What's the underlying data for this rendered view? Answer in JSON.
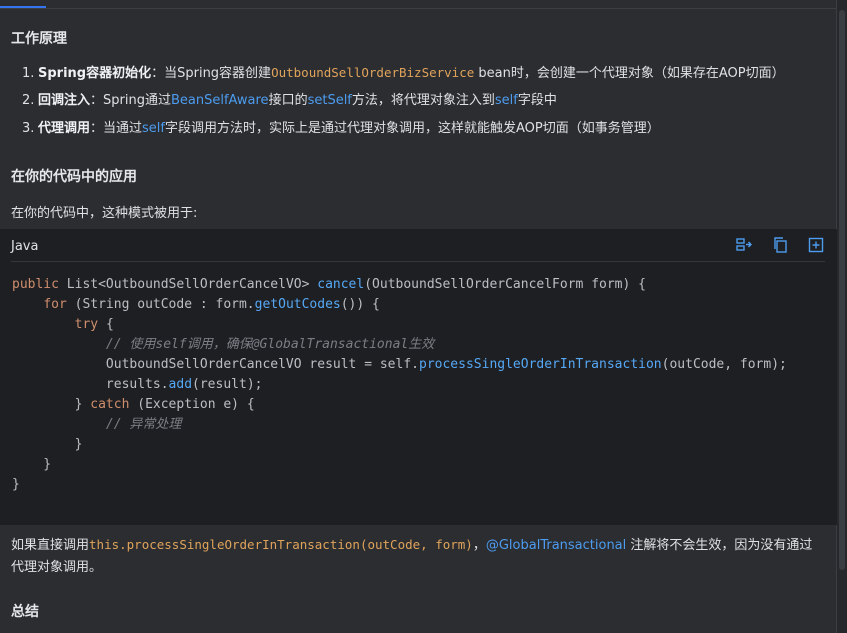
{
  "section_principle": {
    "title": "工作原理",
    "items": [
      {
        "num": "1.",
        "bold": "Spring容器初始化",
        "p1": "：当Spring容器创建",
        "code": "OutboundSellOrderBizService",
        "p2": " bean时，会创建一个代理对象（如果存在AOP切面）"
      },
      {
        "num": "2.",
        "bold": "回调注入",
        "p1": "：Spring通过",
        "link1": "BeanSelfAware",
        "p2": "接口的",
        "link2": "setSelf",
        "p3": "方法，将代理对象注入到",
        "link3": "self",
        "p4": "字段中"
      },
      {
        "num": "3.",
        "bold": "代理调用",
        "p1": "：当通过",
        "link1": "self",
        "p2": "字段调用方法时，实际上是通过代理对象调用，这样就能触发AOP切面（如事务管理）"
      }
    ]
  },
  "section_app": {
    "title": "在你的代码中的应用",
    "intro": "在你的代码中，这种模式被用于:"
  },
  "code_block": {
    "language": "Java",
    "icons": [
      "insert-left-icon",
      "copy-icon",
      "insert-new-file-icon"
    ],
    "lines": {
      "l1_a": "public ",
      "l1_b": "List<OutboundSellOrderCancelVO> ",
      "l1_c": "cancel",
      "l1_d": "(OutboundSellOrderCancelForm form) {",
      "l2_a": "    ",
      "l2_b": "for ",
      "l2_c": "(String outCode : form.",
      "l2_d": "getOutCodes",
      "l2_e": "()) {",
      "l3_a": "        ",
      "l3_b": "try ",
      "l3_c": "{",
      "l4_a": "            ",
      "l4_b": "// 使用self调用，确保@GlobalTransactional生效",
      "l5_a": "            OutboundSellOrderCancelVO result = self.",
      "l5_b": "processSingleOrderInTransaction",
      "l5_c": "(outCode, form);",
      "l6_a": "            results.",
      "l6_b": "add",
      "l6_c": "(result);",
      "l7_a": "        } ",
      "l7_b": "catch ",
      "l7_c": "(Exception e) {",
      "l8_a": "            ",
      "l8_b": "// 异常处理",
      "l9": "        }",
      "l10": "    }",
      "l11": "}"
    }
  },
  "after_text": {
    "p1": "如果直接调用",
    "code": "this.processSingleOrderInTransaction(outCode, form)",
    "p2": "，",
    "link": "@GlobalTransactional",
    "p3": " 注解将不会生效，因为没有通过代理对象调用。"
  },
  "section_summary": {
    "title": "总结"
  }
}
